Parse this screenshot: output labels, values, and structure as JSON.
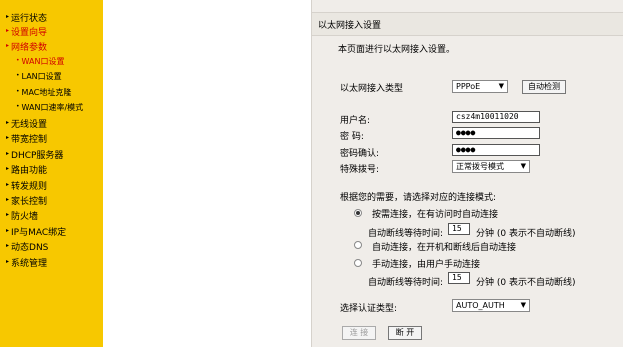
{
  "sidebar": {
    "items": [
      {
        "label": "运行状态"
      },
      {
        "label": "设置向导"
      },
      {
        "label": "网络参数"
      },
      {
        "label": "WAN口设置"
      },
      {
        "label": "LAN口设置"
      },
      {
        "label": "MAC地址克隆"
      },
      {
        "label": "WAN口速率/模式"
      },
      {
        "label": "无线设置"
      },
      {
        "label": "带宽控制"
      },
      {
        "label": "DHCP服务器"
      },
      {
        "label": "路由功能"
      },
      {
        "label": "转发规则"
      },
      {
        "label": "家长控制"
      },
      {
        "label": "防火墙"
      },
      {
        "label": "IP与MAC绑定"
      },
      {
        "label": "动态DNS"
      },
      {
        "label": "系统管理"
      }
    ]
  },
  "panel": {
    "title": "以太网接入设置",
    "intro": "本页面进行以太网接入设置。",
    "access_type_label": "以太网接入类型",
    "access_type_value": "PPPoE",
    "auto_detect_label": "自动检测",
    "username_label": "用户名:",
    "username_value": "csz4m10011020",
    "password_label": "密  码:",
    "password_value": "●●●●",
    "confirm_label": "密码确认:",
    "confirm_value": "●●●●",
    "special_dial_label": "特殊拨号:",
    "special_dial_value": "正常拨号模式",
    "mode_prompt": "根据您的需要，请选择对应的连接模式:",
    "mode_on_demand": "按需连接，在有访问时自动连接",
    "idle_label": "自动断线等待时间:",
    "idle_value": "15",
    "idle_suffix": "分钟 (0 表示不自动断线)",
    "mode_auto": "自动连接，在开机和断线后自动连接",
    "mode_manual": "手动连接，由用户手动连接",
    "idle_value2": "15",
    "auth_label": "选择认证类型:",
    "auth_value": "AUTO_AUTH",
    "connect_label": "连 接",
    "disconnect_label": "断 开"
  }
}
